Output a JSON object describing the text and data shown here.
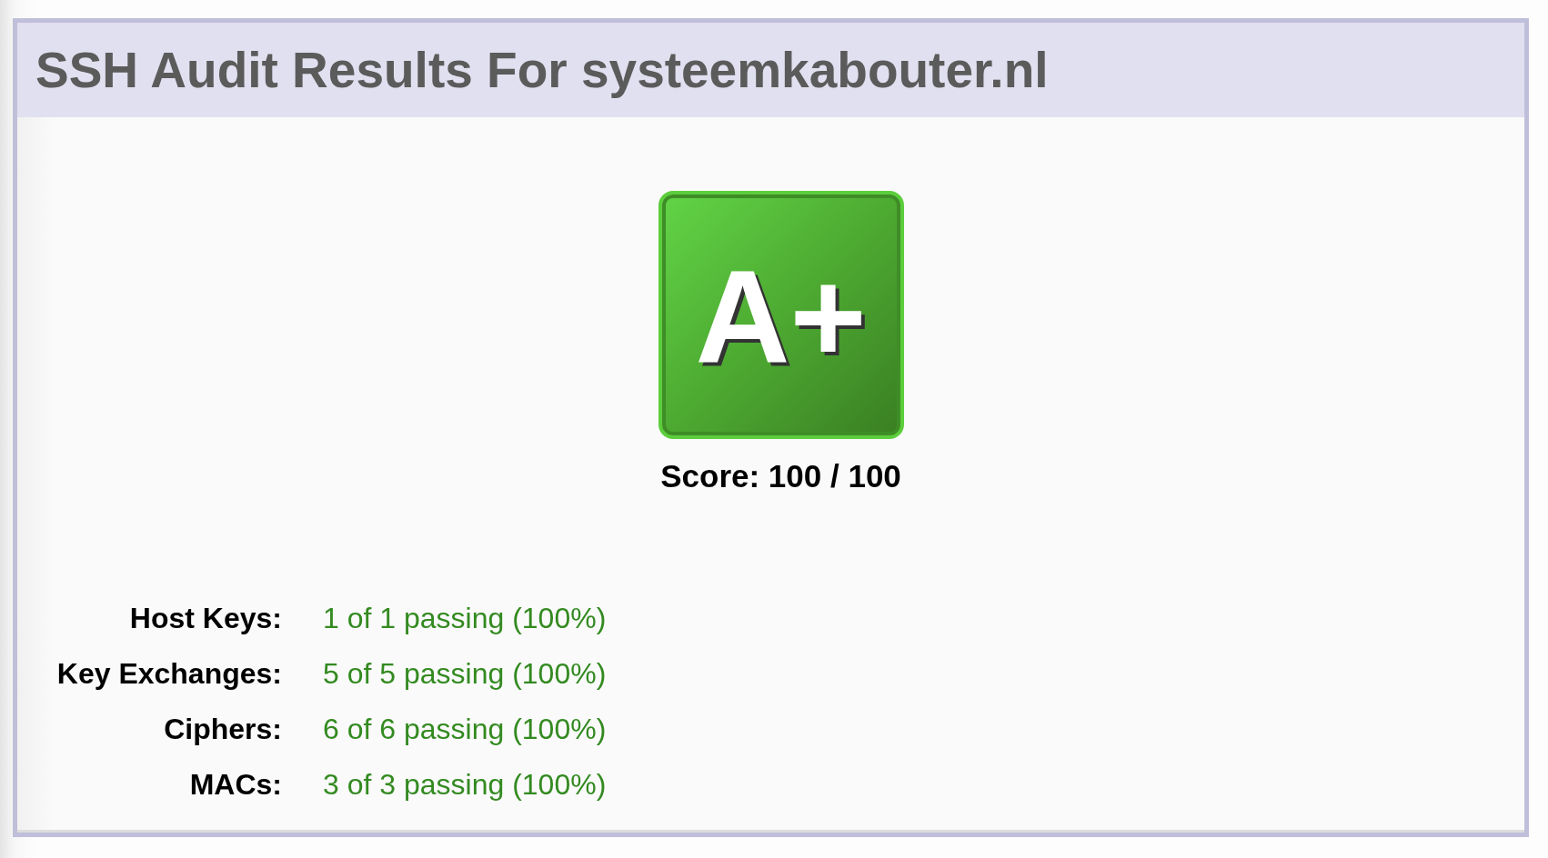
{
  "title": "SSH Audit Results For systeemkabouter.nl",
  "grade": {
    "label": "A+",
    "score": "Score: 100 / 100"
  },
  "results": [
    {
      "label": "Host Keys:",
      "value": "1 of 1 passing (100%)",
      "passing": true
    },
    {
      "label": "Key Exchanges:",
      "value": "5 of 5 passing (100%)",
      "passing": true
    },
    {
      "label": "Ciphers:",
      "value": "6 of 6 passing (100%)",
      "passing": true
    },
    {
      "label": "MACs:",
      "value": "3 of 3 passing (100%)",
      "passing": true
    }
  ]
}
